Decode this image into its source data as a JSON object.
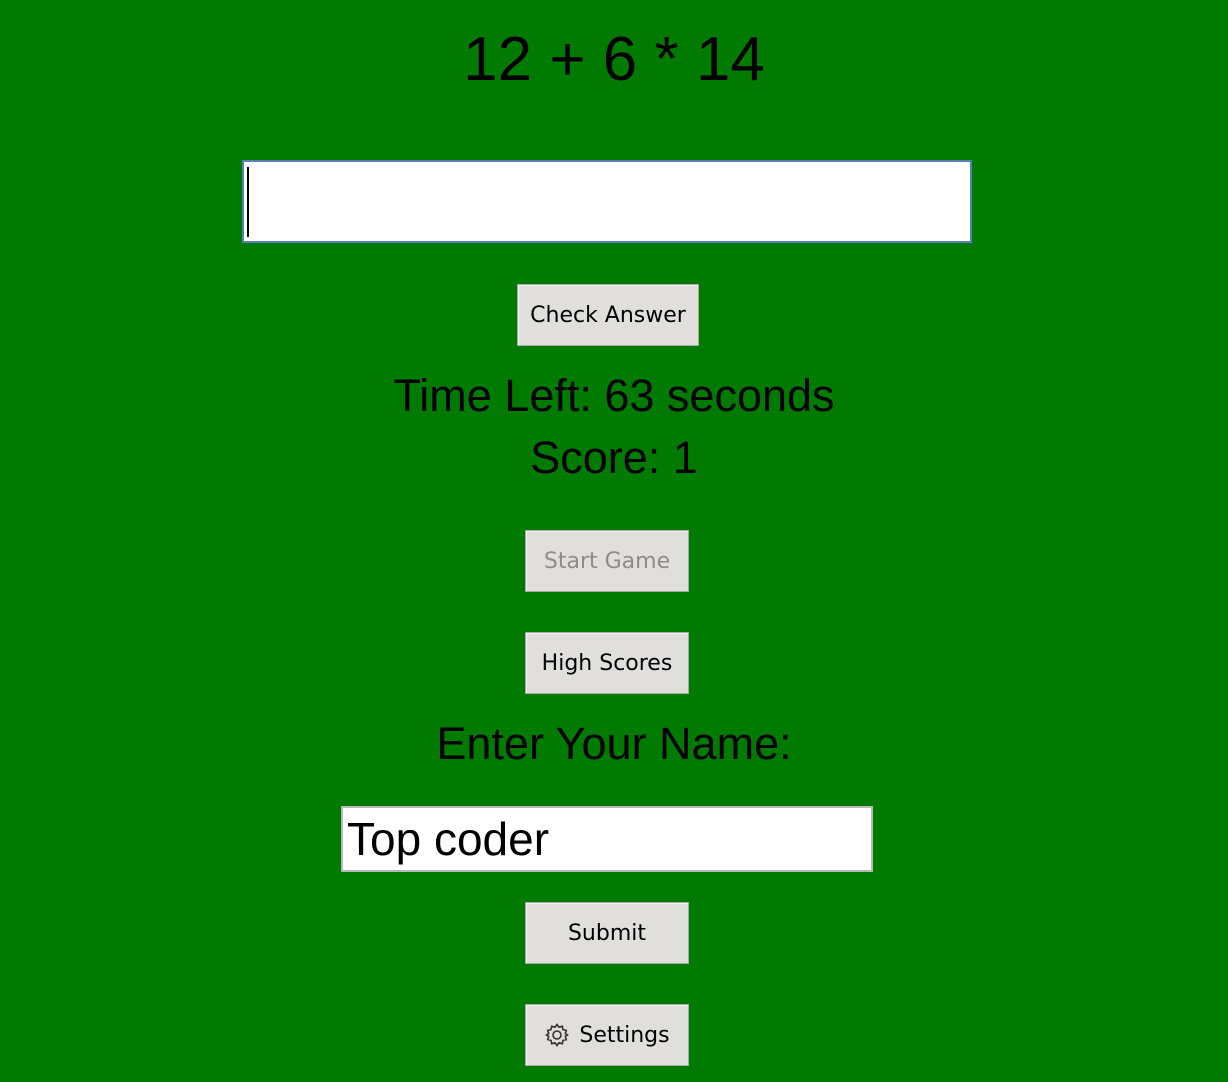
{
  "game": {
    "problem": "12 + 6 * 14",
    "answer_value": "",
    "check_label": "Check Answer",
    "time_left": "Time Left: 63 seconds",
    "score": "Score: 1",
    "start_label": "Start Game",
    "high_scores_label": "High Scores",
    "name_prompt": "Enter Your Name:",
    "name_value": "Top coder",
    "submit_label": "Submit",
    "settings_label": "Settings",
    "settings_icon": "gear-icon"
  },
  "colors": {
    "background": "#007a00",
    "button_face": "#e1dfdb",
    "disabled_text": "#8c8c8c"
  }
}
